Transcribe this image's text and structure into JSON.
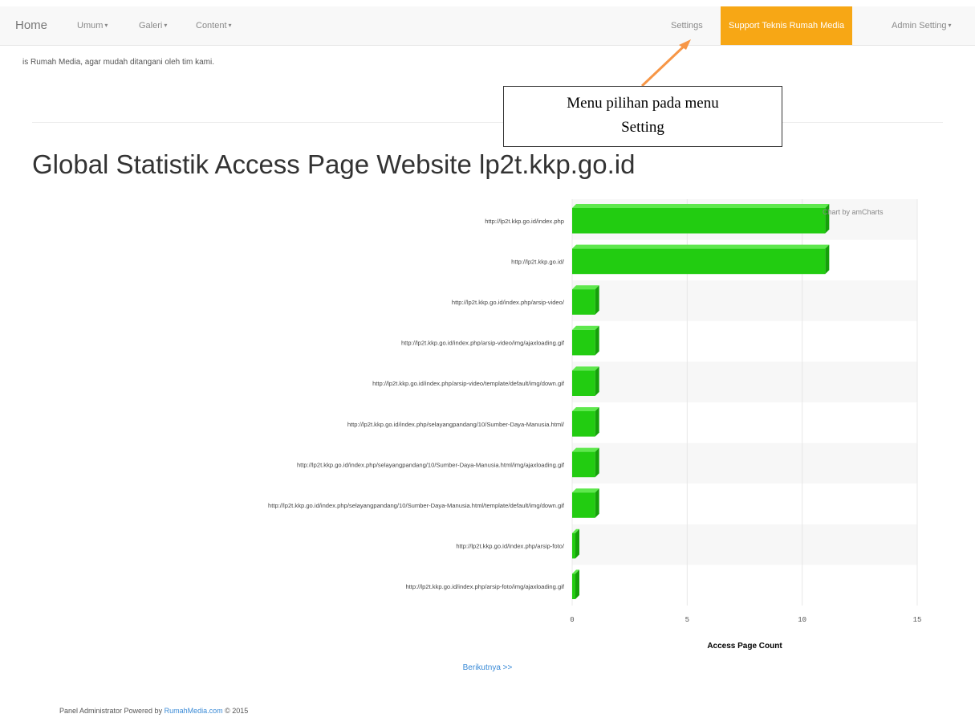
{
  "navbar": {
    "brand": "Home",
    "menus": [
      {
        "label": "Umum"
      },
      {
        "label": "Galeri"
      },
      {
        "label": "Content"
      }
    ],
    "settings": "Settings",
    "support": "Support Teknis Rumah Media",
    "admin": "Admin Setting"
  },
  "notice": "is Rumah Media, agar mudah ditangani oleh tim kami.",
  "callout": {
    "line1": "Menu pilihan pada menu",
    "line2": "Setting"
  },
  "page_title": "Global Statistik Access Page Website lp2t.kkp.go.id",
  "chart_credit": "Chart by amCharts",
  "chart_data": {
    "type": "bar",
    "orientation": "horizontal",
    "categories": [
      "http://lp2t.kkp.go.id/index.php",
      "http://lp2t.kkp.go.id/",
      "http://lp2t.kkp.go.id/index.php/arsip-video/",
      "http://lp2t.kkp.go.id/index.php/arsip-video/img/ajaxloading.gif",
      "http://lp2t.kkp.go.id/index.php/arsip-video/template/default/img/down.gif",
      "http://lp2t.kkp.go.id/index.php/selayangpandang/10/Sumber-Daya-Manusia.html/",
      "http://lp2t.kkp.go.id/index.php/selayangpandang/10/Sumber-Daya-Manusia.html/img/ajaxloading.gif",
      "http://lp2t.kkp.go.id/index.php/selayangpandang/10/Sumber-Daya-Manusia.html/template/default/img/down.gif",
      "http://lp2t.kkp.go.id/index.php/arsip-foto/",
      "http://lp2t.kkp.go.id/index.php/arsip-foto/img/ajaxloading.gif"
    ],
    "values": [
      11,
      11,
      1,
      1,
      1,
      1,
      1,
      1,
      0,
      0
    ],
    "xlabel": "Access Page Count",
    "xlim": [
      0,
      15
    ],
    "ticks": [
      0,
      5,
      10,
      15
    ],
    "bar_color": "#22cc11",
    "grid": true
  },
  "next_link": "Berikutnya >>",
  "footer": {
    "text": "Panel Administrator Powered by ",
    "brand": "RumahMedia.com",
    "suffix": " © 2015"
  }
}
